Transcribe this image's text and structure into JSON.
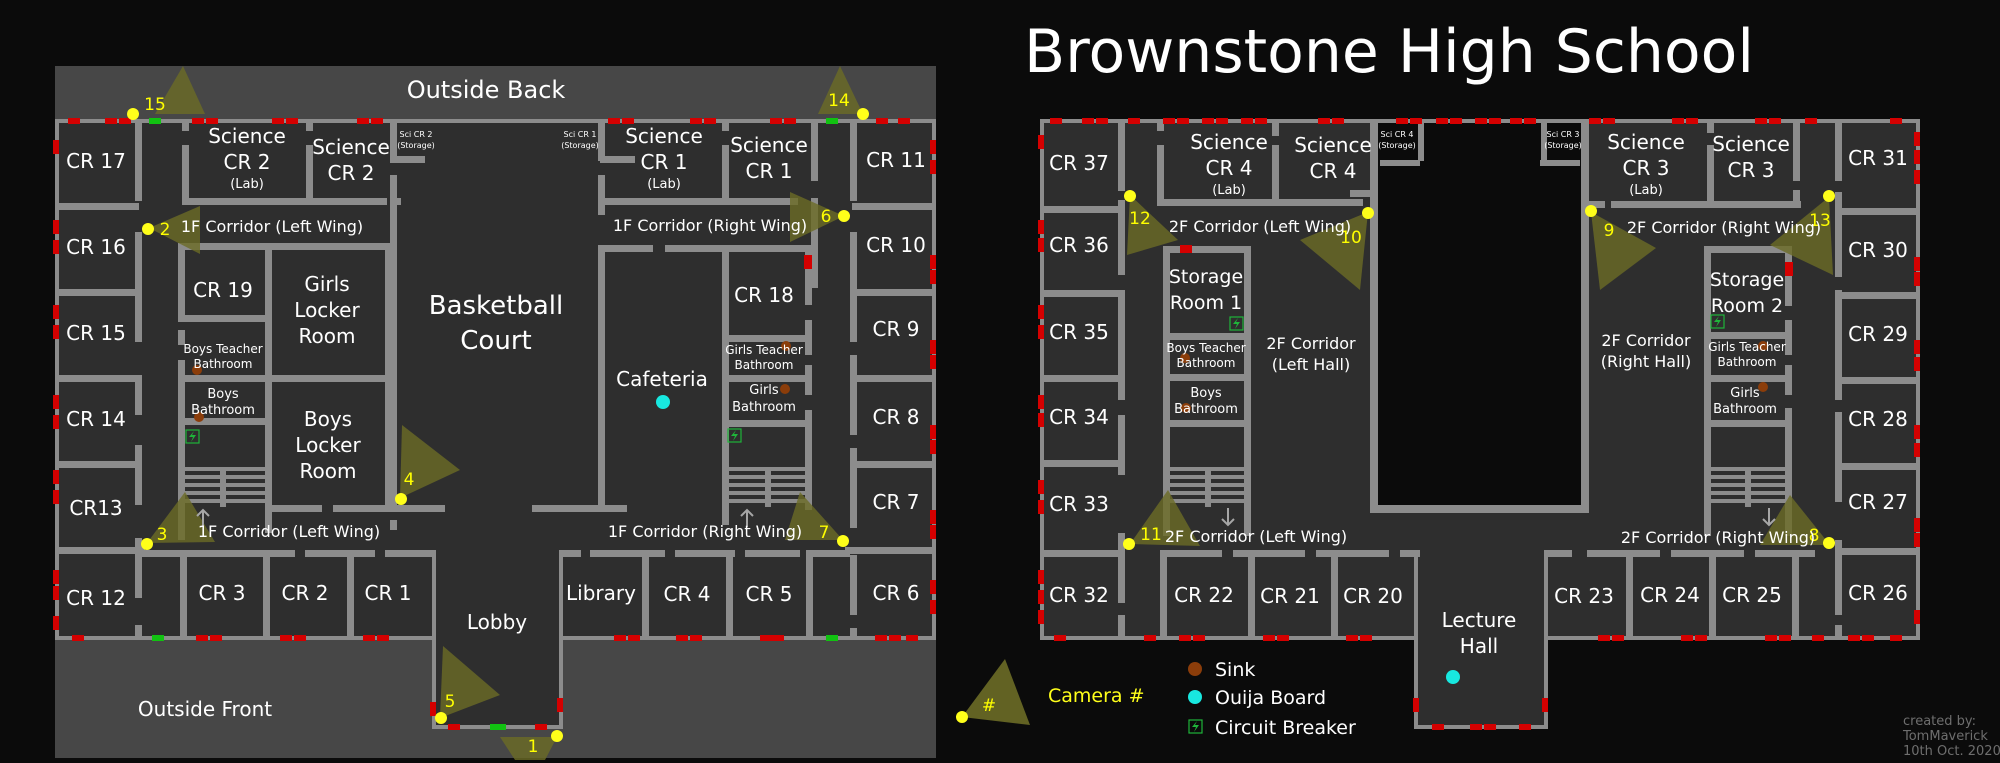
{
  "title": "Brownstone High School",
  "credit": [
    "created by:",
    "TomMaverick",
    "10th Oct. 2020"
  ],
  "colors": {
    "background": "#0b0b0b",
    "outside": "#474747",
    "floor": "#2e2e2e",
    "wall": "#8c8c8c",
    "door": "#d40000",
    "exit_door": "#11c211",
    "camera": "#ffff1a",
    "camera_cone": "#6b6b26",
    "sink": "#8b3d0a",
    "ouija": "#18e8e0",
    "breaker": "#1fb53a"
  },
  "legend": {
    "camera_label": "Camera #",
    "camera_symbol": "#",
    "items": [
      {
        "icon": "sink-icon",
        "label": "Sink"
      },
      {
        "icon": "ouija-board-icon",
        "label": "Ouija Board"
      },
      {
        "icon": "circuit-breaker-icon",
        "label": "Circuit Breaker"
      }
    ]
  },
  "floor1": {
    "areas": {
      "outside_back": "Outside Back",
      "outside_front": "Outside Front"
    },
    "rooms": {
      "cr17": "CR 17",
      "cr16": "CR 16",
      "cr15": "CR 15",
      "cr14": "CR 14",
      "cr13": "CR13",
      "cr12": "CR 12",
      "sci2_lab": [
        "Science",
        "CR 2",
        "(Lab)"
      ],
      "sci2": [
        "Science",
        "CR 2"
      ],
      "sci2_storage": [
        "Sci CR 2",
        "(Storage)"
      ],
      "sci1_storage": [
        "Sci CR 1",
        "(Storage)"
      ],
      "sci1_lab": [
        "Science",
        "CR 1",
        "(Lab)"
      ],
      "sci1": [
        "Science",
        "CR 1"
      ],
      "cr11": "CR 11",
      "cr10": "CR 10",
      "cr9": "CR 9",
      "cr8": "CR 8",
      "cr7": "CR 7",
      "cr6": "CR 6",
      "cr19": "CR 19",
      "girls_locker": [
        "Girls",
        "Locker",
        "Room"
      ],
      "boys_teacher_bath": [
        "Boys Teacher",
        "Bathroom"
      ],
      "boys_bath": [
        "Boys",
        "Bathroom"
      ],
      "boys_locker": [
        "Boys",
        "Locker",
        "Room"
      ],
      "basketball": [
        "Basketball",
        "Court"
      ],
      "cafeteria": "Cafeteria",
      "cr18": "CR 18",
      "girls_teacher_bath": [
        "Girls Teacher",
        "Bathroom"
      ],
      "girls_bath": [
        "Girls",
        "Bathroom"
      ],
      "cr3": "CR 3",
      "cr2": "CR 2",
      "cr1": "CR 1",
      "lobby": "Lobby",
      "library": "Library",
      "cr4": "CR 4",
      "cr5": "CR 5"
    },
    "corridors": {
      "top_left": "1F Corridor (Left Wing)",
      "top_right": "1F Corridor (Right Wing)",
      "bottom_left": "1F Corridor (Left Wing)",
      "bottom_right": "1F Corridor (Right Wing)"
    },
    "cameras": [
      "1",
      "2",
      "3",
      "4",
      "5",
      "6",
      "7",
      "14",
      "15"
    ]
  },
  "floor2": {
    "rooms": {
      "cr37": "CR 37",
      "cr36": "CR 36",
      "cr35": "CR 35",
      "cr34": "CR 34",
      "cr33": "CR 33",
      "cr32": "CR 32",
      "sci4_lab": [
        "Science",
        "CR 4",
        "(Lab)"
      ],
      "sci4": [
        "Science",
        "CR 4"
      ],
      "sci4_storage": [
        "Sci CR 4",
        "(Storage)"
      ],
      "sci3_storage": [
        "Sci CR 3",
        "(Storage)"
      ],
      "sci3_lab": [
        "Science",
        "CR 3",
        "(Lab)"
      ],
      "sci3": [
        "Science",
        "CR 3"
      ],
      "cr31": "CR 31",
      "cr30": "CR 30",
      "cr29": "CR 29",
      "cr28": "CR 28",
      "cr27": "CR 27",
      "cr26": "CR 26",
      "storage1": [
        "Storage",
        "Room 1"
      ],
      "storage2": [
        "Storage",
        "Room 2"
      ],
      "boys_teacher_bath": [
        "Boys Teacher",
        "Bathroom"
      ],
      "boys_bath": [
        "Boys",
        "Bathroom"
      ],
      "girls_teacher_bath": [
        "Girls Teacher",
        "Bathroom"
      ],
      "girls_bath": [
        "Girls",
        "Bathroom"
      ],
      "left_hall": [
        "2F Corridor",
        "(Left Hall)"
      ],
      "right_hall": [
        "2F Corridor",
        "(Right Hall)"
      ],
      "cr22": "CR 22",
      "cr21": "CR 21",
      "cr20": "CR 20",
      "lecture": [
        "Lecture",
        "Hall"
      ],
      "cr23": "CR 23",
      "cr24": "CR 24",
      "cr25": "CR 25"
    },
    "corridors": {
      "top_left": "2F Corridor (Left Wing)",
      "top_right": "2F Corridor (Right Wing)",
      "bottom_left": "2F Corridor (Left Wing)",
      "bottom_right": "2F Corridor (Right Wing)"
    },
    "cameras": [
      "8",
      "9",
      "10",
      "11",
      "12",
      "13"
    ]
  }
}
